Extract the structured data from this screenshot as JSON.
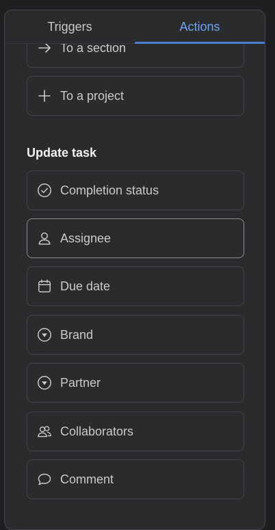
{
  "tabs": {
    "triggers": "Triggers",
    "actions": "Actions",
    "active": "Actions"
  },
  "move_items": [
    {
      "label": "To a section",
      "icon": "arrow-right-icon"
    },
    {
      "label": "To a project",
      "icon": "plus-icon"
    }
  ],
  "update_task": {
    "title": "Update task",
    "items": [
      {
        "label": "Completion status",
        "icon": "check-circle-icon"
      },
      {
        "label": "Assignee",
        "icon": "person-icon",
        "selected": true
      },
      {
        "label": "Due date",
        "icon": "calendar-icon"
      },
      {
        "label": "Brand",
        "icon": "dropdown-circle-icon"
      },
      {
        "label": "Partner",
        "icon": "dropdown-circle-icon"
      },
      {
        "label": "Collaborators",
        "icon": "people-icon"
      },
      {
        "label": "Comment",
        "icon": "comment-icon"
      }
    ]
  },
  "colors": {
    "accent": "#4b7fd3",
    "panel_bg": "#2a2b2d",
    "text": "#c9cacc"
  }
}
